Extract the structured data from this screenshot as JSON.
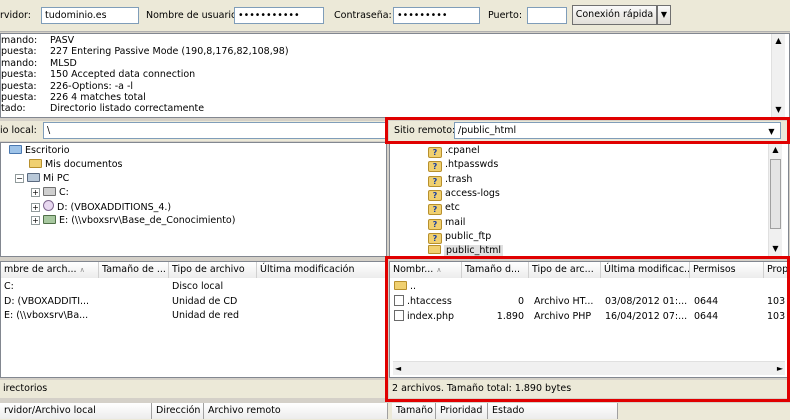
{
  "quickconnect": {
    "server_label": "rvidor:",
    "server_value": "tudominio.es",
    "user_label": "Nombre de usuario:",
    "user_value": "•••••••••••",
    "password_label": "Contraseña:",
    "password_value": "•••••••••",
    "port_label": "Puerto:",
    "port_value": "",
    "connect_button": "Conexión rápida"
  },
  "log": {
    "lines": [
      {
        "type": "mando:",
        "text": "PASV"
      },
      {
        "type": "puesta:",
        "text": "227 Entering Passive Mode (190,8,176,82,108,98)"
      },
      {
        "type": "mando:",
        "text": "MLSD"
      },
      {
        "type": "puesta:",
        "text": "150 Accepted data connection"
      },
      {
        "type": "puesta:",
        "text": "226-Options: -a -l"
      },
      {
        "type": "puesta:",
        "text": "226 4 matches total"
      },
      {
        "type": "tado:",
        "text": "Directorio listado correctamente"
      }
    ]
  },
  "local": {
    "label": "io local:",
    "path": "\\",
    "tree": [
      "Escritorio",
      "Mis documentos",
      "Mi PC",
      "C:",
      "D: (VBOXADDITIONS_4.)",
      "E: (\\\\vboxsrv\\Base_de_Conocimiento)"
    ],
    "columns": [
      "mbre de arch...",
      "Tamaño de ...",
      "Tipo de archivo",
      "Última modificación"
    ],
    "rows": [
      {
        "name": "C:",
        "type": "Disco local"
      },
      {
        "name": "D: (VBOXADDITI...",
        "type": "Unidad de CD"
      },
      {
        "name": "E: (\\\\vboxsrv\\Ba...",
        "type": "Unidad de red"
      }
    ],
    "status": "irectorios"
  },
  "remote": {
    "label": "Sitio remoto:",
    "path": "/public_html",
    "tree": [
      ".cpanel",
      ".htpasswds",
      ".trash",
      "access-logs",
      "etc",
      "mail",
      "public_ftp",
      "public_html"
    ],
    "columns": [
      "Nombr...",
      "Tamaño d...",
      "Tipo de arc...",
      "Última modificac...",
      "Permisos",
      "Prop"
    ],
    "rows": [
      {
        "name": "..",
        "size": "",
        "type": "",
        "modified": "",
        "perms": "",
        "owner": ""
      },
      {
        "name": ".htaccess",
        "size": "0",
        "type": "Archivo HT...",
        "modified": "03/08/2012 01:...",
        "perms": "0644",
        "owner": "103"
      },
      {
        "name": "index.php",
        "size": "1.890",
        "type": "Archivo PHP",
        "modified": "16/04/2012 07:...",
        "perms": "0644",
        "owner": "103"
      }
    ],
    "status": "2 archivos. Tamaño total: 1.890 bytes"
  },
  "queue": {
    "columns": [
      "rvidor/Archivo local",
      "Dirección",
      "Archivo remoto",
      "Tamaño",
      "Prioridad",
      "Estado"
    ]
  },
  "colors": {
    "highlight": "#e00000",
    "accent_folder": "#f0d070"
  }
}
